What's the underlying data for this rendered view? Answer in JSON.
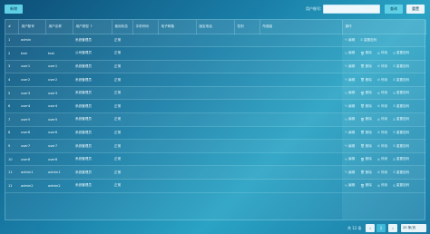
{
  "toolbar": {
    "add_label": "新增",
    "search_label": "用户账号:",
    "search_placeholder": "",
    "search_button": "查询",
    "reset_button": "重置"
  },
  "table": {
    "columns": [
      "#",
      "用户账号",
      "用户名称",
      "用户类型",
      "使用状态",
      "手机号码",
      "电子邮箱",
      "固定电话",
      "性别",
      "所属组",
      "操作"
    ],
    "sort_indicator": "↑",
    "rows": [
      {
        "no": "1",
        "account": "admin",
        "name": "",
        "type": "系统管理员",
        "status": "正常"
      },
      {
        "no": "2",
        "account": "test",
        "name": "test",
        "type": "公司管理员",
        "status": "正常"
      },
      {
        "no": "3",
        "account": "user1",
        "name": "user1",
        "type": "系统管理员",
        "status": "正常"
      },
      {
        "no": "4",
        "account": "user2",
        "name": "user2",
        "type": "系统管理员",
        "status": "正常"
      },
      {
        "no": "5",
        "account": "user3",
        "name": "user3",
        "type": "系统管理员",
        "status": "正常"
      },
      {
        "no": "6",
        "account": "user4",
        "name": "user4",
        "type": "系统管理员",
        "status": "正常"
      },
      {
        "no": "7",
        "account": "user5",
        "name": "user5",
        "type": "系统管理员",
        "status": "正常"
      },
      {
        "no": "8",
        "account": "user6",
        "name": "user6",
        "type": "系统管理员",
        "status": "正常"
      },
      {
        "no": "9",
        "account": "user7",
        "name": "user7",
        "type": "系统管理员",
        "status": "正常"
      },
      {
        "no": "10",
        "account": "user8",
        "name": "user8",
        "type": "系统管理员",
        "status": "正常"
      },
      {
        "no": "11",
        "account": "admin1",
        "name": "admin1",
        "type": "系统管理员",
        "status": "正常"
      },
      {
        "no": "12",
        "account": "admin2",
        "name": "admin2",
        "type": "系统管理员",
        "status": "正常"
      }
    ],
    "ops": {
      "edit": "编辑",
      "delete": "删除",
      "disable": "停用",
      "reset_pwd": "重置密码"
    }
  },
  "pager": {
    "total": "共 12 条",
    "prev": "‹",
    "page": "1",
    "next": "›",
    "size": "20 条/页"
  },
  "colors": {
    "accent": "#5fd0e6",
    "bg": "#1a7fa8"
  }
}
